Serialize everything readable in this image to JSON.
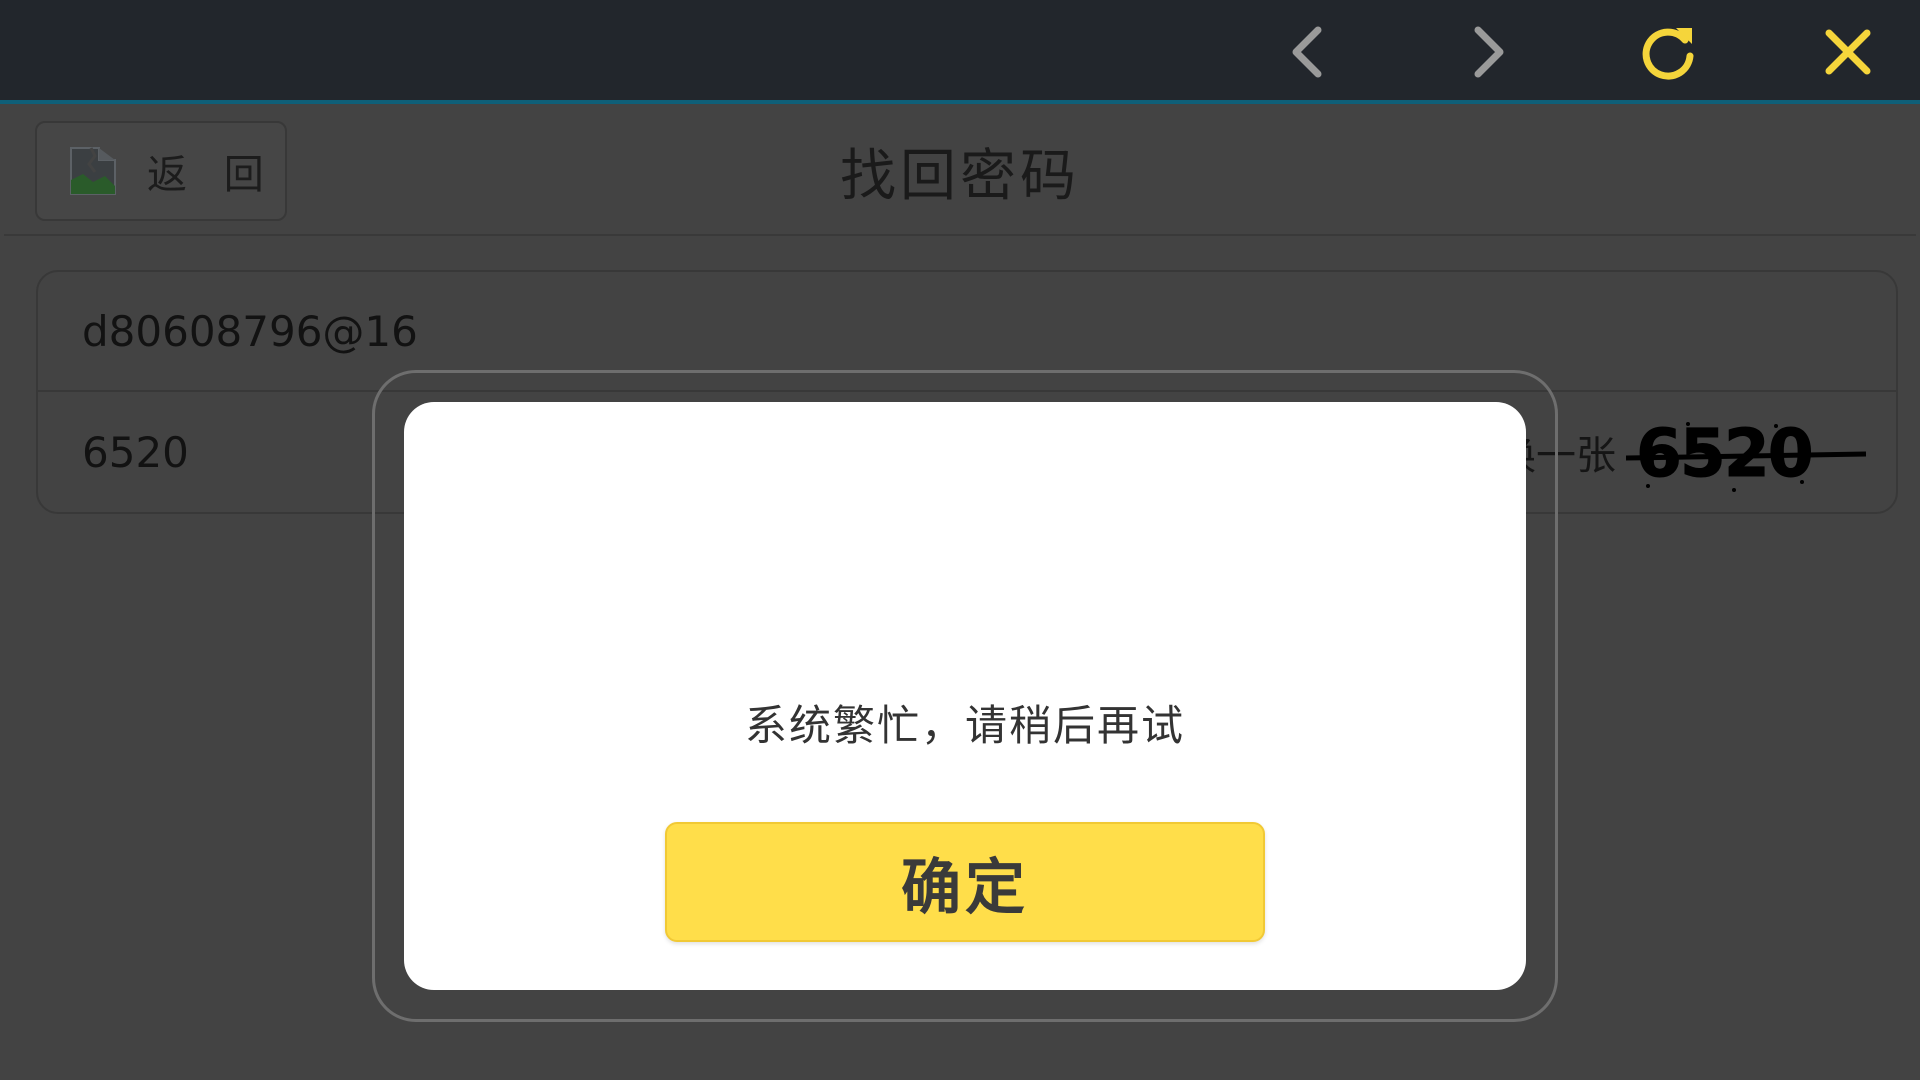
{
  "topbar": {
    "back_icon": "chevron-left-icon",
    "forward_icon": "chevron-right-icon",
    "refresh_icon": "refresh-icon",
    "close_icon": "close-icon",
    "icon_color_gray": "#9a9a9a",
    "icon_color_yellow": "#f5d53b",
    "background": "#22262c"
  },
  "header": {
    "back_label": "返 回",
    "title": "找回密码"
  },
  "form": {
    "email_value": "d80608796@16",
    "captcha_input_value": "6520",
    "refresh_captcha_label": "换一张",
    "captcha_text": "6520"
  },
  "dialog": {
    "message": "系统繁忙，请稍后再试",
    "confirm_label": "确定",
    "confirm_color": "#ffde4a"
  }
}
